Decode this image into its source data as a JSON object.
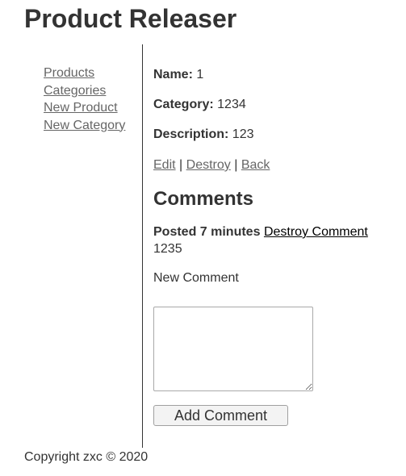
{
  "site": {
    "title": "Product Releaser"
  },
  "sidebar": {
    "items": [
      {
        "label": "Products"
      },
      {
        "label": "Categories"
      },
      {
        "label": "New Product"
      },
      {
        "label": "New Category"
      }
    ]
  },
  "product": {
    "name_label": "Name:",
    "name_value": "1",
    "category_label": "Category:",
    "category_value": "1234",
    "description_label": "Description:",
    "description_value": "123"
  },
  "actions": {
    "edit": "Edit",
    "destroy": "Destroy",
    "back": "Back",
    "separator": "|"
  },
  "comments": {
    "heading": "Comments",
    "items": [
      {
        "meta": "Posted 7 minutes",
        "destroy_label": "Destroy Comment",
        "body": "1235"
      }
    ]
  },
  "new_comment": {
    "label": "New Comment",
    "value": "",
    "submit_label": "Add Comment"
  },
  "footer": {
    "text": "Copyright zxc © 2020"
  }
}
